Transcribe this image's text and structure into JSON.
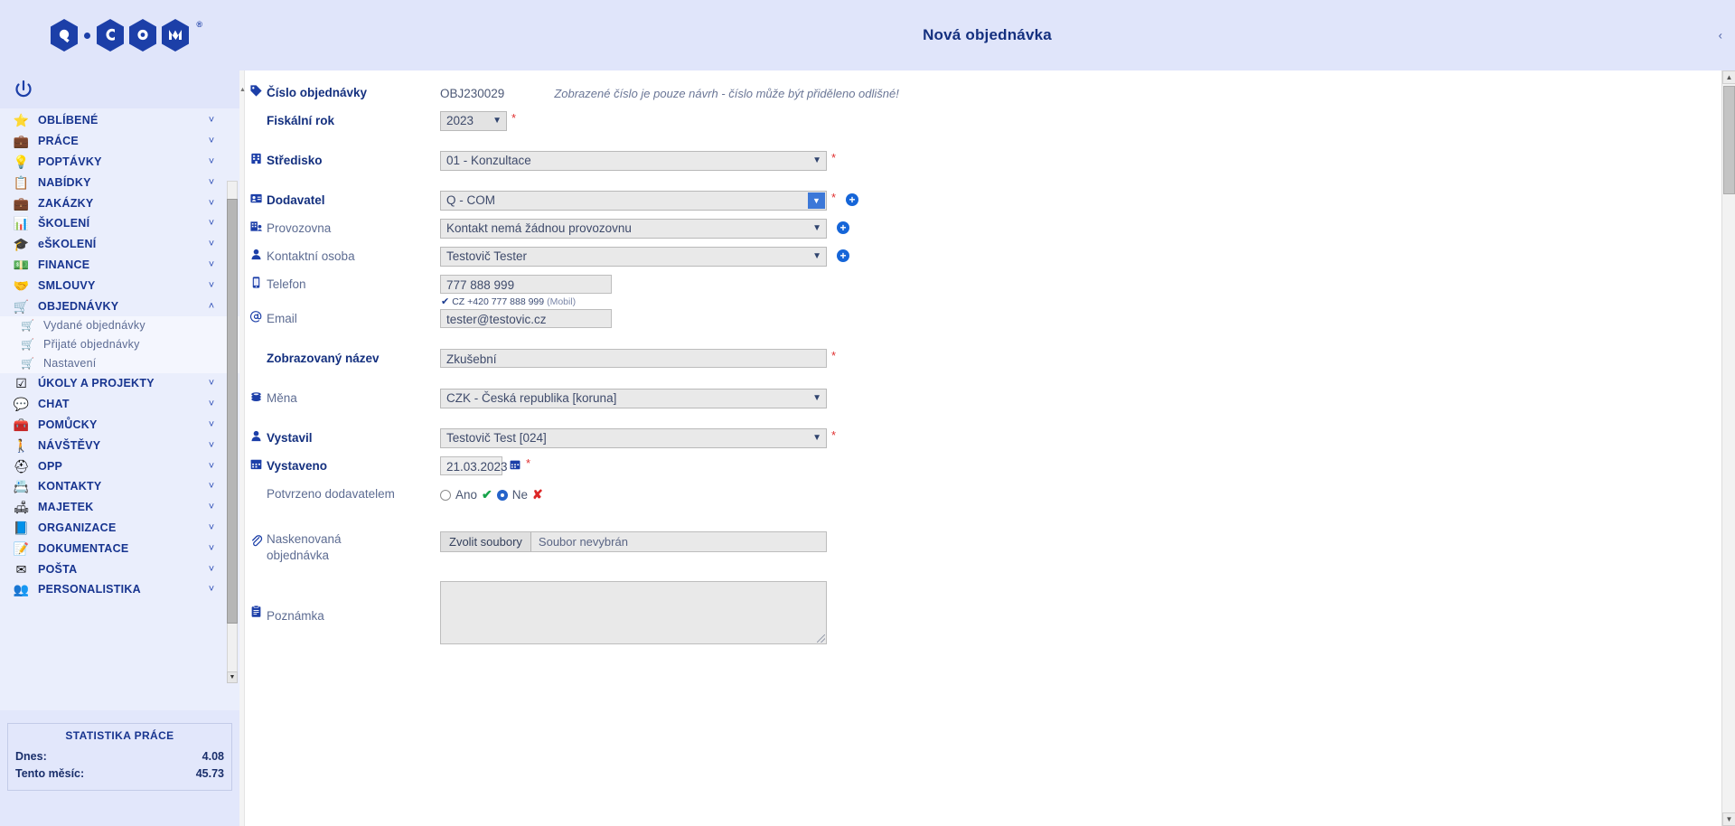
{
  "app": {
    "logo_letters": [
      "Q",
      "C",
      "O",
      "M"
    ],
    "logo_registered": "®",
    "power_icon": "power-icon"
  },
  "titlebar": {
    "title": "Nová objednávka",
    "right_glyph": "‹"
  },
  "sidebar": {
    "items": [
      {
        "label": "OBLÍBENÉ",
        "icon": "star-icon",
        "chevron": "˅",
        "expanded": false
      },
      {
        "label": "PRÁCE",
        "icon": "briefcase-icon",
        "chevron": "˅",
        "expanded": false
      },
      {
        "label": "POPTÁVKY",
        "icon": "lightbulb-icon",
        "chevron": "˅",
        "expanded": false
      },
      {
        "label": "NABÍDKY",
        "icon": "clipboard-icon",
        "chevron": "˅",
        "expanded": false
      },
      {
        "label": "ZAKÁZKY",
        "icon": "toolcase-icon",
        "chevron": "˅",
        "expanded": false
      },
      {
        "label": "ŠKOLENÍ",
        "icon": "whiteboard-icon",
        "chevron": "˅",
        "expanded": false
      },
      {
        "label": "eŠKOLENÍ",
        "icon": "graduation-cap-icon",
        "chevron": "˅",
        "expanded": false
      },
      {
        "label": "FINANCE",
        "icon": "money-icon",
        "chevron": "˅",
        "expanded": false
      },
      {
        "label": "SMLOUVY",
        "icon": "handshake-icon",
        "chevron": "˅",
        "expanded": false
      },
      {
        "label": "OBJEDNÁVKY",
        "icon": "cart-icon",
        "chevron": "˄",
        "expanded": true
      },
      {
        "label": "ÚKOLY A PROJEKTY",
        "icon": "checklist-icon",
        "chevron": "˅",
        "expanded": false
      },
      {
        "label": "CHAT",
        "icon": "chat-icon",
        "chevron": "˅",
        "expanded": false
      },
      {
        "label": "POMŮCKY",
        "icon": "toolbox-icon",
        "chevron": "˅",
        "expanded": false
      },
      {
        "label": "NÁVŠTĚVY",
        "icon": "walking-person-icon",
        "chevron": "˅",
        "expanded": false
      },
      {
        "label": "OPP",
        "icon": "helmet-icon",
        "chevron": "˅",
        "expanded": false
      },
      {
        "label": "KONTAKTY",
        "icon": "contact-card-icon",
        "chevron": "˅",
        "expanded": false
      },
      {
        "label": "MAJETEK",
        "icon": "armchair-icon",
        "chevron": "˅",
        "expanded": false
      },
      {
        "label": "ORGANIZACE",
        "icon": "org-chart-icon",
        "chevron": "˅",
        "expanded": false
      },
      {
        "label": "DOKUMENTACE",
        "icon": "documents-icon",
        "chevron": "˅",
        "expanded": false
      },
      {
        "label": "POŠTA",
        "icon": "mail-icon",
        "chevron": "˅",
        "expanded": false
      },
      {
        "label": "PERSONALISTIKA",
        "icon": "people-icon",
        "chevron": "˅",
        "expanded": false
      }
    ],
    "orders_submenu": [
      {
        "label": "Vydané objednávky",
        "icon": "cart-icon"
      },
      {
        "label": "Přijaté objednávky",
        "icon": "cart-icon"
      },
      {
        "label": "Nastavení",
        "icon": "cart-icon"
      }
    ],
    "statistics": {
      "title": "STATISTIKA PRÁCE",
      "rows": [
        {
          "label": "Dnes:",
          "value": "4.08"
        },
        {
          "label": "Tento měsíc:",
          "value": "45.73"
        }
      ]
    }
  },
  "form": {
    "order_number": {
      "label": "Číslo objednávky",
      "value": "OBJ230029",
      "hint": "Zobrazené číslo je pouze návrh - číslo může být přiděleno odlišné!",
      "icon": "tag-icon"
    },
    "fiscal_year": {
      "label": "Fiskální rok",
      "value": "2023",
      "required": "*"
    },
    "center": {
      "label": "Středisko",
      "value": "01 - Konzultace",
      "required": "*",
      "icon": "building-icon"
    },
    "supplier": {
      "label": "Dodavatel",
      "value": "Q - COM",
      "required": "*",
      "icon": "id-card-icon",
      "add_button": "+"
    },
    "branch": {
      "label": "Provozovna",
      "value": "Kontakt nemá žádnou provozovnu",
      "icon": "branch-icon",
      "add_button": "+"
    },
    "contact_person": {
      "label": "Kontaktní osoba",
      "value": "Testovič Tester",
      "icon": "person-icon",
      "add_button": "+"
    },
    "phone": {
      "label": "Telefon",
      "value": "777 888 999",
      "icon": "phone-icon",
      "verified_check": "✔",
      "verified_text": "CZ +420 777 888 999",
      "verified_type": "(Mobil)"
    },
    "email": {
      "label": "Email",
      "value": "tester@testovic.cz",
      "icon": "at-icon"
    },
    "display_name": {
      "label": "Zobrazovaný název",
      "value": "Zkušební",
      "required": "*"
    },
    "currency": {
      "label": "Měna",
      "value": "CZK - Česká republika [koruna]",
      "icon": "coins-icon"
    },
    "issued_by": {
      "label": "Vystavil",
      "value": "Testovič Test [024]",
      "required": "*",
      "icon": "person-icon"
    },
    "issued_on": {
      "label": "Vystaveno",
      "value": "21.03.2023",
      "required": "*",
      "icon": "calendar-icon",
      "picker_icon": "calendar-picker-icon"
    },
    "confirmed_by_supplier": {
      "label": "Potvrzeno dodavatelem",
      "option_yes": "Ano",
      "option_no": "Ne",
      "yes_mark": "✔",
      "no_mark": "✘",
      "selected": "Ne"
    },
    "scanned_order": {
      "label_line1": "Naskenovaná",
      "label_line2": "objednávka",
      "button": "Zvolit soubory",
      "file_status": "Soubor nevybrán",
      "icon": "paperclip-icon"
    },
    "note": {
      "label": "Poznámka",
      "value": "",
      "icon": "note-icon"
    }
  },
  "colors": {
    "brand_blue": "#1c3fa8",
    "sidebar_bg": "#e8ecfb",
    "title_bg": "#e0e5fa",
    "required_red": "#e03131",
    "accent_blue": "#1565d8",
    "yes_green": "#16a34a",
    "no_red": "#dc2626"
  }
}
